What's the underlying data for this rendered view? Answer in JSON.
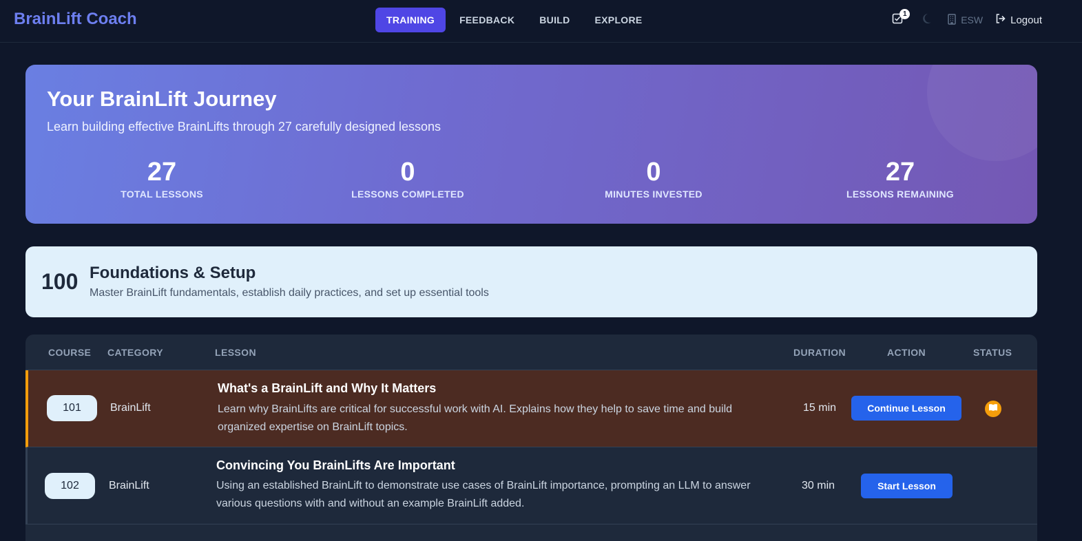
{
  "app": {
    "brand": "BrainLift Coach",
    "accent": "#4f46e5"
  },
  "nav": {
    "tabs": [
      {
        "label": "TRAINING",
        "active": true
      },
      {
        "label": "FEEDBACK",
        "active": false
      },
      {
        "label": "BUILD",
        "active": false
      },
      {
        "label": "EXPLORE",
        "active": false
      }
    ],
    "tasks_icon": "checkbox-icon",
    "tasks_badge": "1",
    "theme_icon": "moon-icon",
    "org_icon": "building-icon",
    "org_label": "ESW",
    "logout_icon": "logout-icon",
    "logout_label": "Logout"
  },
  "hero": {
    "title": "Your BrainLift Journey",
    "subtitle": "Learn building effective BrainLifts through 27 carefully designed lessons",
    "stats": [
      {
        "value": "27",
        "label": "TOTAL LESSONS"
      },
      {
        "value": "0",
        "label": "LESSONS COMPLETED"
      },
      {
        "value": "0",
        "label": "MINUTES INVESTED"
      },
      {
        "value": "27",
        "label": "LESSONS REMAINING"
      }
    ]
  },
  "section": {
    "number": "100",
    "title": "Foundations & Setup",
    "description": "Master BrainLift fundamentals, establish daily practices, and set up essential tools"
  },
  "table": {
    "headers": {
      "course": "COURSE",
      "category": "CATEGORY",
      "lesson": "LESSON",
      "duration": "DURATION",
      "action": "ACTION",
      "status": "STATUS"
    },
    "rows": [
      {
        "course": "101",
        "category": "BrainLift",
        "title": "What's a BrainLift and Why It Matters",
        "description": "Learn why BrainLifts are critical for successful work with AI. Explains how they help to save time and build organized expertise on BrainLift topics.",
        "duration": "15 min",
        "action": "Continue Lesson",
        "status_icon": "book-open-icon",
        "status_color": "#f59e0b",
        "in_progress": true
      },
      {
        "course": "102",
        "category": "BrainLift",
        "title": "Convincing You BrainLifts Are Important",
        "description": "Using an established BrainLift to demonstrate use cases of BrainLift importance, prompting an LLM to answer various questions with and without an example BrainLift added.",
        "duration": "30 min",
        "action": "Start Lesson",
        "in_progress": false
      }
    ]
  }
}
